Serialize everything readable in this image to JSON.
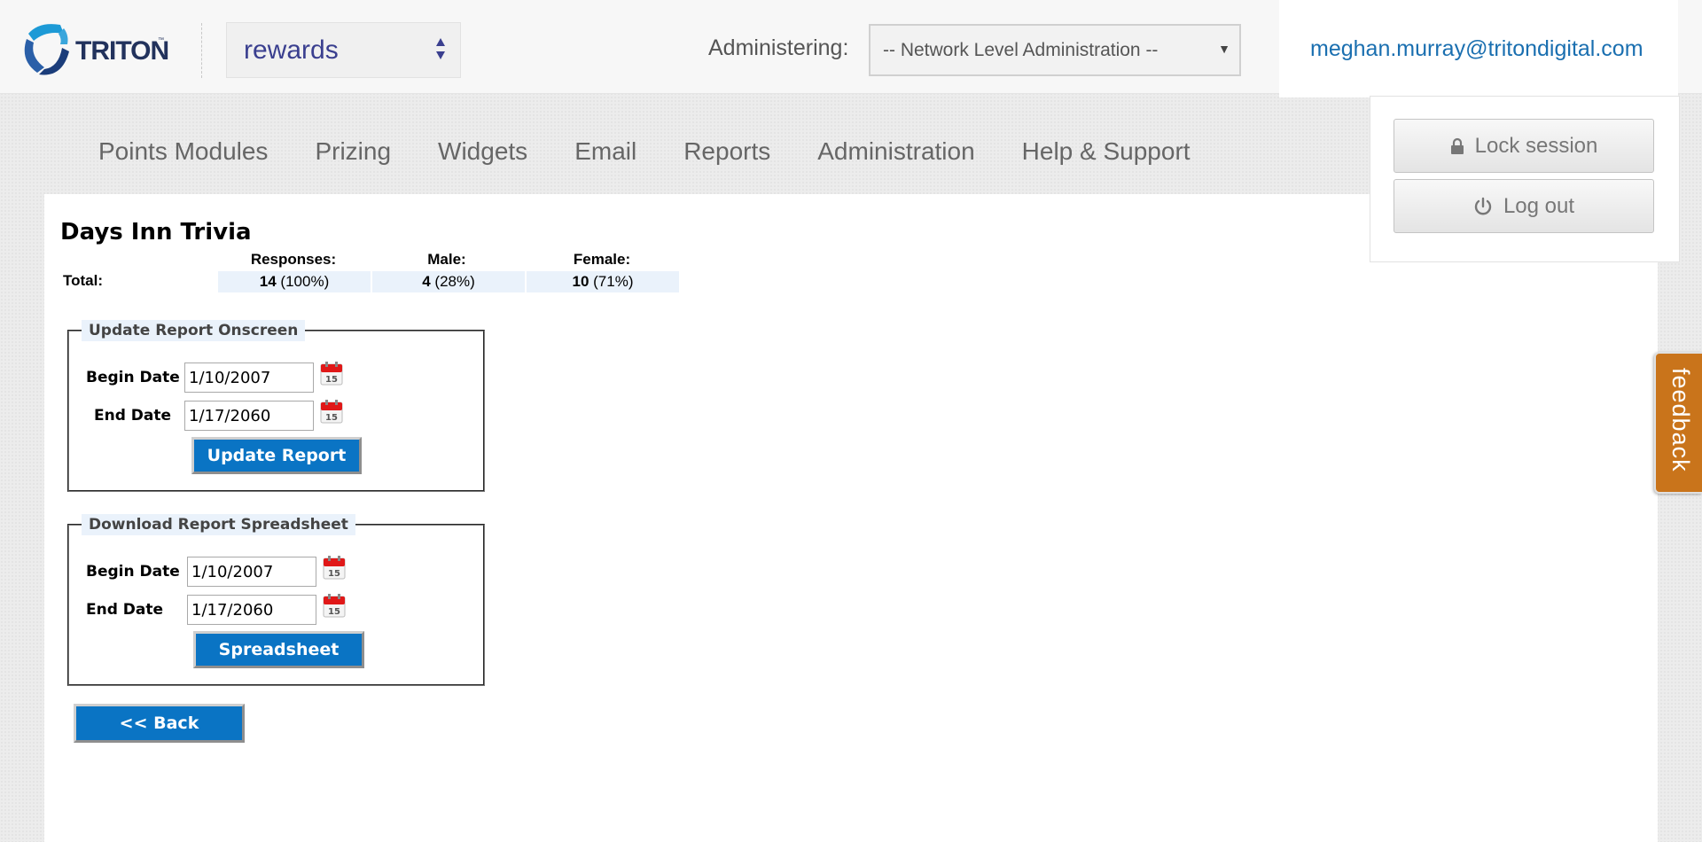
{
  "header": {
    "logo_text": "TRITON",
    "app_select_value": "rewards",
    "administering_label": "Administering:",
    "administering_value": "-- Network Level Administration --",
    "user_email": "meghan.murray@tritondigital.com"
  },
  "user_menu": {
    "lock_label": "Lock session",
    "logout_label": "Log out"
  },
  "nav": {
    "items": [
      {
        "label": "Points Modules"
      },
      {
        "label": "Prizing"
      },
      {
        "label": "Widgets"
      },
      {
        "label": "Email"
      },
      {
        "label": "Reports"
      },
      {
        "label": "Administration"
      },
      {
        "label": "Help & Support"
      }
    ]
  },
  "report": {
    "title": "Days Inn Trivia",
    "headers": {
      "responses": "Responses:",
      "male": "Male:",
      "female": "Female:"
    },
    "total_label": "Total:",
    "responses": {
      "count": "14",
      "pct": "(100%)"
    },
    "male": {
      "count": "4",
      "pct": "(28%)"
    },
    "female": {
      "count": "10",
      "pct": "(71%)"
    }
  },
  "onscreen": {
    "legend": "Update Report Onscreen",
    "begin_label": "Begin Date",
    "begin_value": "1/10/2007",
    "end_label": "End Date",
    "end_value": "1/17/2060",
    "button_label": "Update Report"
  },
  "spreadsheet": {
    "legend": "Download Report Spreadsheet",
    "begin_label": "Begin Date",
    "begin_value": "1/10/2007",
    "end_label": "End Date",
    "end_value": "1/17/2060",
    "button_label": "Spreadsheet"
  },
  "calendar_icon_text": "15",
  "back_label": "<< Back",
  "feedback_label": "feedback",
  "colors": {
    "brand_blue": "#0a74c4",
    "link_blue": "#1a6fb0",
    "feedback_orange": "#c9741b"
  }
}
